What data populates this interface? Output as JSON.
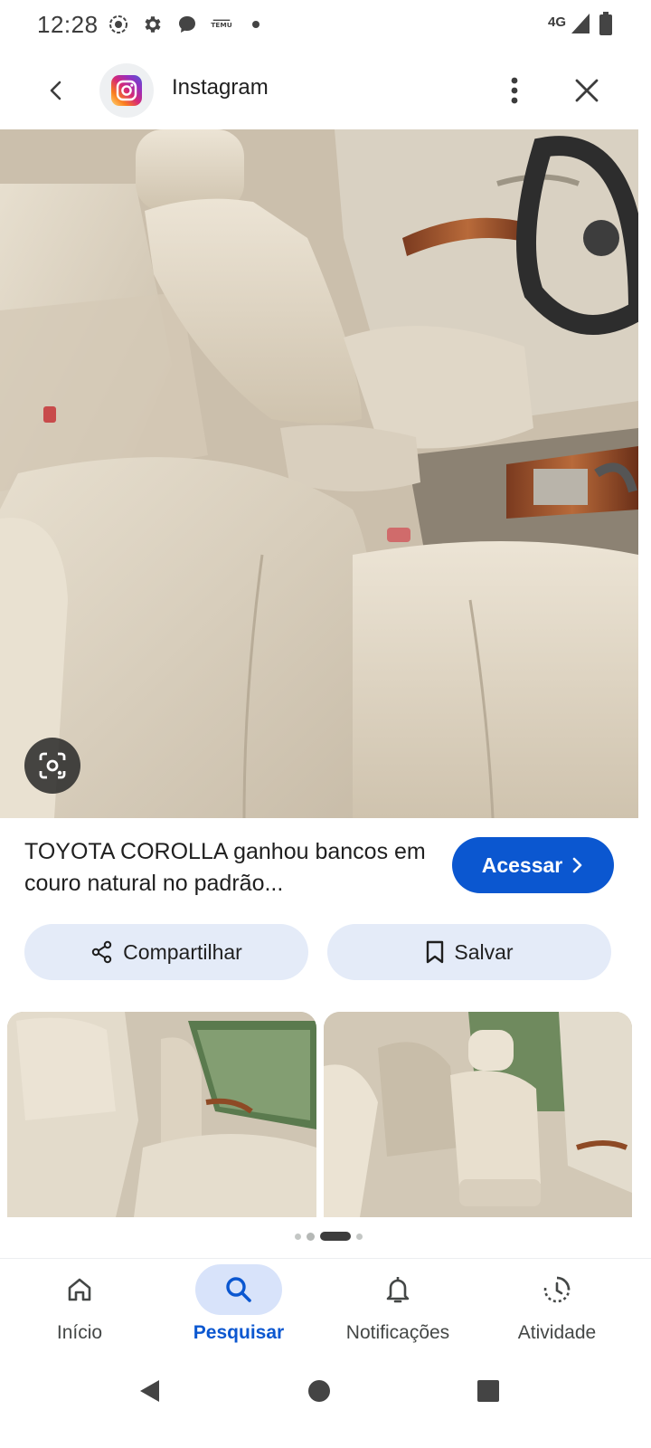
{
  "status_bar": {
    "time": "12:28",
    "network": "4G",
    "icons": [
      "screen-record-icon",
      "settings-icon",
      "chat-icon",
      "temu-icon",
      "notification-dot-icon",
      "signal-icon",
      "battery-icon"
    ],
    "temu_label": "TEMU"
  },
  "header": {
    "title": "Instagram",
    "app_icon": "instagram-logo"
  },
  "result": {
    "title": "TOYOTA COROLLA ganhou bancos em couro natural no padrão...",
    "visit_label": "Acessar",
    "share_label": "Compartilhar",
    "save_label": "Salvar"
  },
  "related": {
    "pages": 4,
    "active_page": 3
  },
  "bottom_nav": {
    "items": [
      {
        "label": "Início",
        "icon": "home-icon"
      },
      {
        "label": "Pesquisar",
        "icon": "search-icon"
      },
      {
        "label": "Notificações",
        "icon": "bell-icon"
      },
      {
        "label": "Atividade",
        "icon": "activity-icon"
      }
    ],
    "active_index": 1
  },
  "colors": {
    "accent": "#0b57d0",
    "tonal_button": "#e4ebf8",
    "active_pill": "#d8e3fa"
  }
}
